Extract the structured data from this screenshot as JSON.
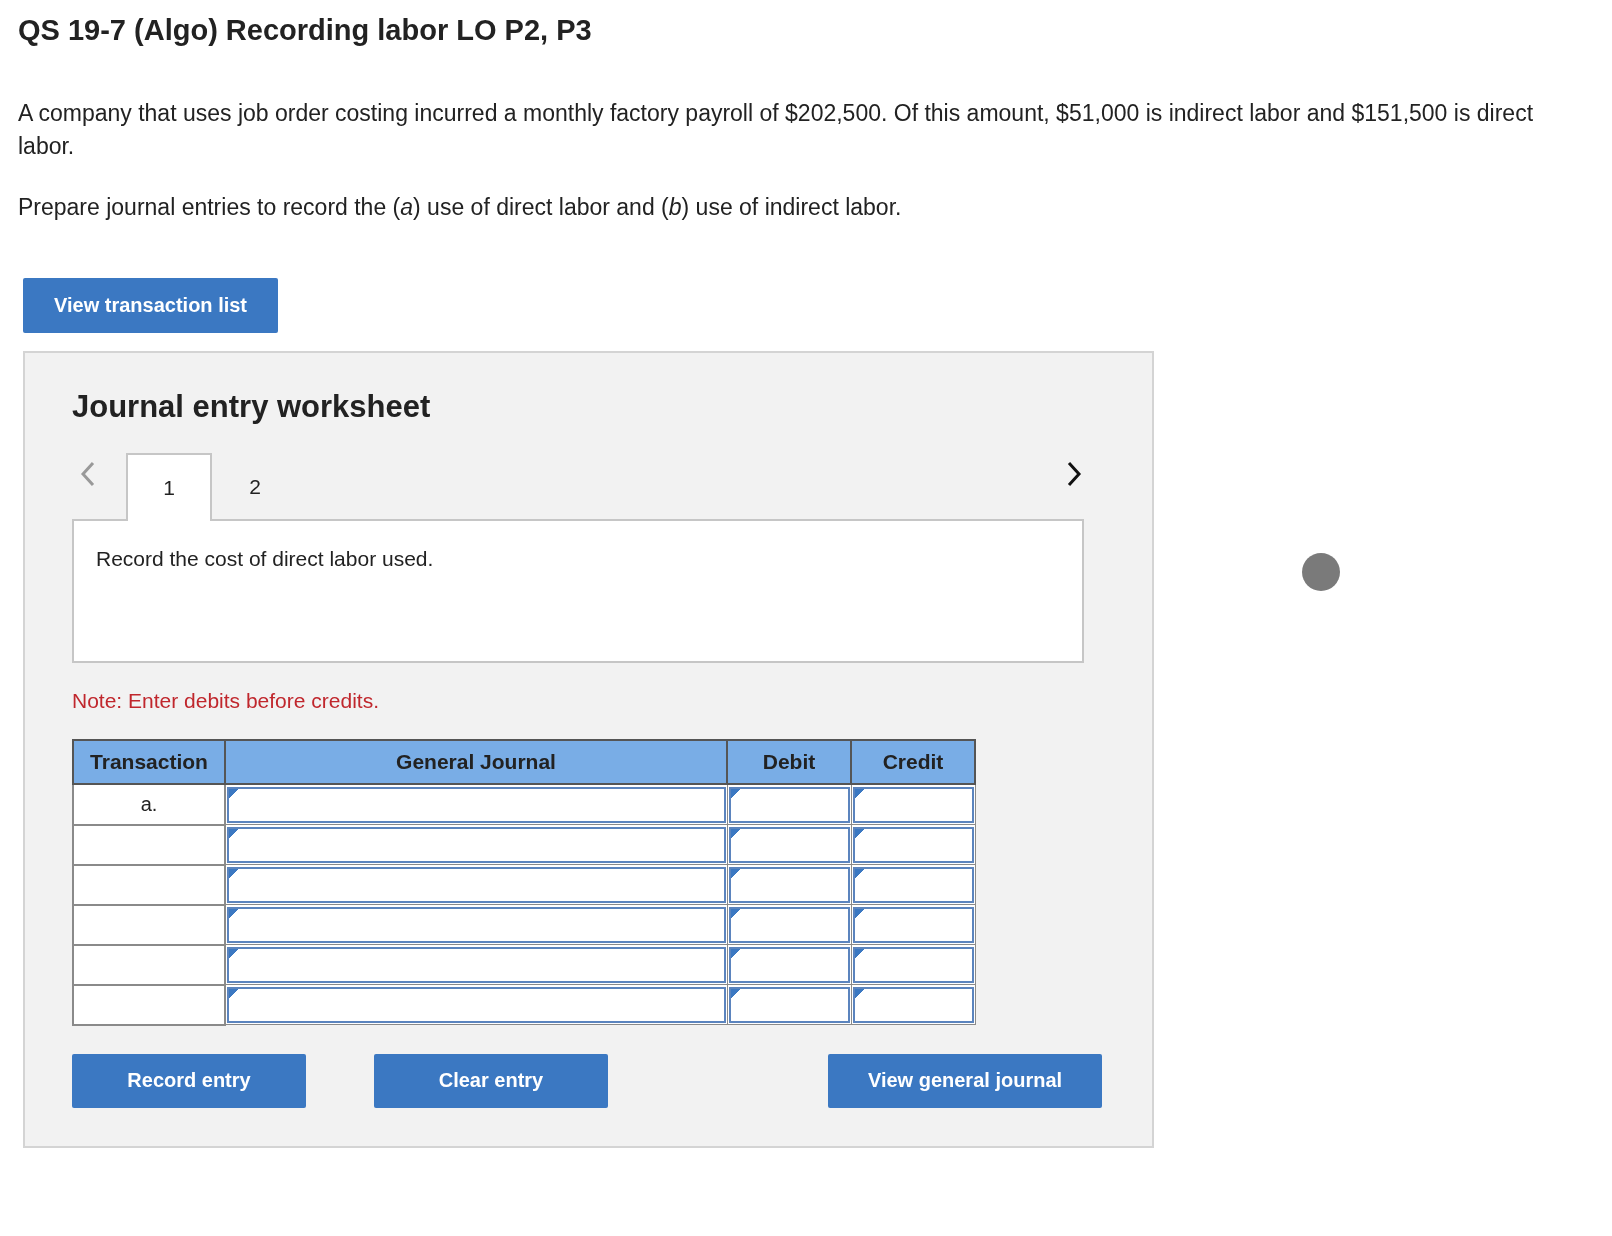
{
  "title": "QS 19-7 (Algo) Recording labor LO P2, P3",
  "paragraphs": [
    "A company that uses job order costing incurred a monthly factory payroll of $202,500. Of this amount, $51,000 is indirect labor and $151,500 is direct labor.",
    "Prepare journal entries to record the (*a*) use of direct labor and (*b*) use of indirect labor."
  ],
  "view_transaction_button": "View transaction list",
  "worksheet": {
    "heading": "Journal entry worksheet",
    "nav": {
      "prev_disabled": true,
      "next_disabled": false
    },
    "tabs": [
      {
        "label": "1",
        "selected": true
      },
      {
        "label": "2",
        "selected": false
      }
    ],
    "prompt": "Record the cost of direct labor used.",
    "note": "Note: Enter debits before credits.",
    "columns": [
      "Transaction",
      "General Journal",
      "Debit",
      "Credit"
    ],
    "rows": [
      {
        "transaction": "a."
      },
      {},
      {},
      {},
      {},
      {}
    ],
    "buttons": [
      "Record entry",
      "Clear entry",
      "View general journal"
    ]
  }
}
